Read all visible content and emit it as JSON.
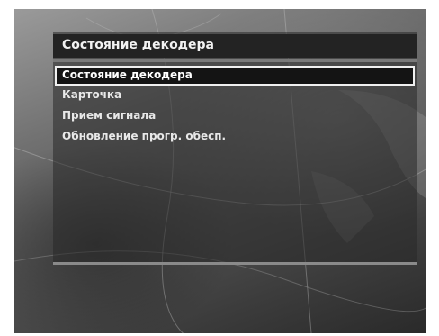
{
  "menu": {
    "title": "Состояние декодера",
    "items": [
      {
        "label": "Состояние декодера",
        "selected": true
      },
      {
        "label": "Карточка",
        "selected": false
      },
      {
        "label": "Прием сигнала",
        "selected": false
      },
      {
        "label": "Обновление прогр. обесп.",
        "selected": false
      }
    ]
  }
}
